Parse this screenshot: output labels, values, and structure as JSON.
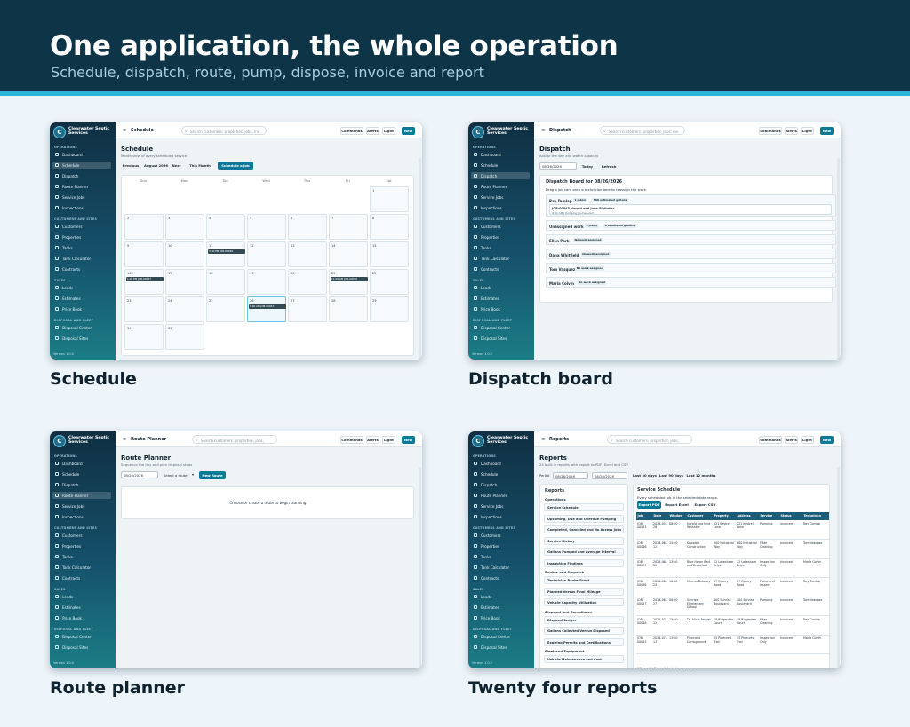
{
  "hero": {
    "title": "One application, the whole operation",
    "subtitle": "Schedule, dispatch, route, pump, dispose, invoice and report"
  },
  "colors": {
    "hero_bg": "#0e3447",
    "accent": "#2bb7d8",
    "primary": "#0b7a96",
    "sidebar": "#15506a"
  },
  "app": {
    "brand": "Clearwater Septic Services",
    "logo_letter": "C",
    "search_placeholder": "Search customers, properties, jobs, inv",
    "search_placeholder_alt": "Search customers, properties, jobs,",
    "top_buttons": {
      "commands": "Commands",
      "alerts": "Alerts",
      "light": "Light",
      "new": "New"
    },
    "version": "Version 1.0.0",
    "nav": [
      {
        "type": "section",
        "label": "OPERATIONS"
      },
      {
        "type": "item",
        "label": "Dashboard",
        "icon": "dashboard-icon"
      },
      {
        "type": "item",
        "label": "Schedule",
        "icon": "calendar-icon"
      },
      {
        "type": "item",
        "label": "Dispatch",
        "icon": "dispatch-icon"
      },
      {
        "type": "item",
        "label": "Route Planner",
        "icon": "route-icon"
      },
      {
        "type": "item",
        "label": "Service Jobs",
        "icon": "wrench-icon"
      },
      {
        "type": "item",
        "label": "Inspections",
        "icon": "clipboard-icon"
      },
      {
        "type": "section",
        "label": "CUSTOMERS AND SITES"
      },
      {
        "type": "item",
        "label": "Customers",
        "icon": "user-icon"
      },
      {
        "type": "item",
        "label": "Properties",
        "icon": "home-icon"
      },
      {
        "type": "item",
        "label": "Tanks",
        "icon": "tank-icon"
      },
      {
        "type": "item",
        "label": "Tank Calculator",
        "icon": "calculator-icon"
      },
      {
        "type": "item",
        "label": "Contracts",
        "icon": "document-icon"
      },
      {
        "type": "section",
        "label": "SALES"
      },
      {
        "type": "item",
        "label": "Leads",
        "icon": "lead-icon"
      },
      {
        "type": "item",
        "label": "Estimates",
        "icon": "estimate-icon"
      },
      {
        "type": "item",
        "label": "Price Book",
        "icon": "book-icon"
      },
      {
        "type": "section",
        "label": "DISPOSAL AND FLEET"
      },
      {
        "type": "item",
        "label": "Disposal Center",
        "icon": "disposal-icon"
      },
      {
        "type": "item",
        "label": "Disposal Sites",
        "icon": "pin-icon"
      }
    ]
  },
  "panels": [
    {
      "caption": "Schedule",
      "tb_title": "Schedule",
      "active": "Schedule",
      "title": "Schedule",
      "subtitle": "Month view of every scheduled service",
      "toolbar": {
        "previous": "Previous",
        "month": "August 2026",
        "next": "Next",
        "this_month": "This Month",
        "schedule": "Schedule a Job"
      },
      "weekdays": [
        "Sun",
        "Mon",
        "Tue",
        "Wed",
        "Thu",
        "Fri",
        "Sat"
      ],
      "days": [
        "1",
        "2",
        "3",
        "4",
        "5",
        "6",
        "7",
        "8",
        "9",
        "10",
        "11",
        "12",
        "13",
        "14",
        "15",
        "16",
        "17",
        "18",
        "19",
        "20",
        "21",
        "22",
        "23",
        "24",
        "25",
        "26",
        "27",
        "28",
        "29",
        "30",
        "31"
      ],
      "events": [
        {
          "day": "11",
          "label": "3:00 PM JOB-00048"
        },
        {
          "day": "16",
          "label": "1:00 PM JOB-00047"
        },
        {
          "day": "21",
          "label": "11:00 AM JOB-00050"
        },
        {
          "day": "26",
          "label": "9:00 AM JOB-00043"
        }
      ]
    },
    {
      "caption": "Dispatch board",
      "tb_title": "Dispatch",
      "active": "Dispatch",
      "title": "Dispatch",
      "subtitle": "Assign the day and watch capacity",
      "date": "08/26/2026",
      "today": "Today",
      "refresh": "Refresh",
      "board_title": "Dispatch Board for 08/26/2026",
      "hint": "Drag a job card onto a technician lane to reassign the work.",
      "lanes": [
        {
          "name": "Ray Dunlap",
          "badges": [
            "1 job(s)",
            "500 estimated gallons"
          ],
          "job": "JOB-00045 Harold and June Whitaker",
          "job_sub": "9:00 AM | Pumping | scheduled"
        },
        {
          "name": "Unassigned work",
          "badges": [
            "0 job(s)",
            "0 estimated gallons"
          ]
        },
        {
          "name": "Ellen Park",
          "badges": [
            "No work assigned"
          ]
        },
        {
          "name": "Dana Whitfield",
          "badges": [
            "No work assigned"
          ]
        },
        {
          "name": "Tom Vasquez",
          "badges": [
            "No work assigned"
          ]
        },
        {
          "name": "Maria Colvin",
          "badges": [
            "No work assigned"
          ]
        }
      ]
    },
    {
      "caption": "Route planner",
      "tb_title": "Route Planner",
      "active": "Route Planner",
      "title": "Route Planner",
      "subtitle": "Sequence the day and plan disposal stops",
      "date": "08/26/2026",
      "select": "Select a route",
      "new_route": "New Route",
      "empty": "Choose or create a route to begin planning."
    },
    {
      "caption": "Twenty four reports",
      "tb_title": "Reports",
      "active": "",
      "title": "Reports",
      "subtitle": "24 built in reports with export to PDF, Excel and CSV",
      "period_label": "Period",
      "date_from": "08/26/2026",
      "date_to": "08/26/2026",
      "ranges": [
        "Last 30 days",
        "Last 90 days",
        "Last 12 months"
      ],
      "list_title": "Reports",
      "categories": [
        {
          "name": "Operations",
          "items": [
            "Service Schedule",
            "Upcoming, Due and Overdue Pumping",
            "Completed, Canceled and No Access Jobs",
            "Service History",
            "Gallons Pumped and Average Interval",
            "Inspection Findings"
          ]
        },
        {
          "name": "Routes and Dispatch",
          "items": [
            "Technician Route Sheet",
            "Planned Versus Final Mileage",
            "Vehicle Capacity Utilization"
          ]
        },
        {
          "name": "Disposal and Compliance",
          "items": [
            "Disposal Ledger",
            "Gallons Collected Versus Disposed",
            "Expiring Permits and Certifications"
          ]
        },
        {
          "name": "Fleet and Equipment",
          "items": [
            "Vehicle Maintenance and Cost"
          ]
        }
      ],
      "report_title": "Service Schedule",
      "report_desc": "Every scheduled job in the selected date range.",
      "exports": [
        "Export PDF",
        "Export Excel",
        "Export CSV"
      ],
      "columns": [
        "Job",
        "Date",
        "Window",
        "Customer",
        "Property",
        "Address",
        "Service",
        "Status",
        "Technician"
      ],
      "rows": [
        [
          "JOB-00033",
          "2026-05-28",
          "08:00",
          "Harold and June Whitaker",
          "221 Kestrel Lane",
          "221 Kestrel Lane",
          "Pumping",
          "Invoiced",
          "Ray Dunlap"
        ],
        [
          "JOB-00046",
          "2026-06-12",
          "15:00",
          "Kowalski Construction",
          "600 Industrial Way",
          "600 Industrial Way",
          "Filter Cleaning",
          "Invoiced",
          "Tom Vasquez"
        ],
        [
          "JOB-00035",
          "2026-06-15",
          "13:00",
          "Blue Heron Bed and Breakfast",
          "12 Lakeshore Drive",
          "12 Lakeshore Drive",
          "Inspection Only",
          "Invoiced",
          "Maria Colvin"
        ],
        [
          "JOB-00036",
          "2026-06-22",
          "10:00",
          "Marcus Delaney",
          "87 Quarry Road",
          "87 Quarry Road",
          "Pump and Inspect",
          "Invoiced",
          "Ray Dunlap"
        ],
        [
          "JOB-00037",
          "2026-06-27",
          "08:00",
          "Sunrise Elementary School",
          "400 Sunrise Boulevard",
          "400 Sunrise Boulevard",
          "Pumping",
          "Invoiced",
          "Tom Vasquez"
        ],
        [
          "JOB-00048",
          "2026-07-12",
          "15:00",
          "Dr. Alicia Fenner",
          "18 Ridgeview Court",
          "18 Ridgeview Court",
          "Filter Cleaning",
          "Invoiced",
          "Ray Dunlap"
        ],
        [
          "JOB-00043",
          "2026-07-17",
          "13:00",
          "Pinecrest Campground",
          "55 Pinecrest Trail",
          "55 Pinecrest Trail",
          "Inspection Only",
          "Invoiced",
          "Maria Colvin"
        ]
      ],
      "footer": "19 row(s). Exports include every row."
    }
  ]
}
